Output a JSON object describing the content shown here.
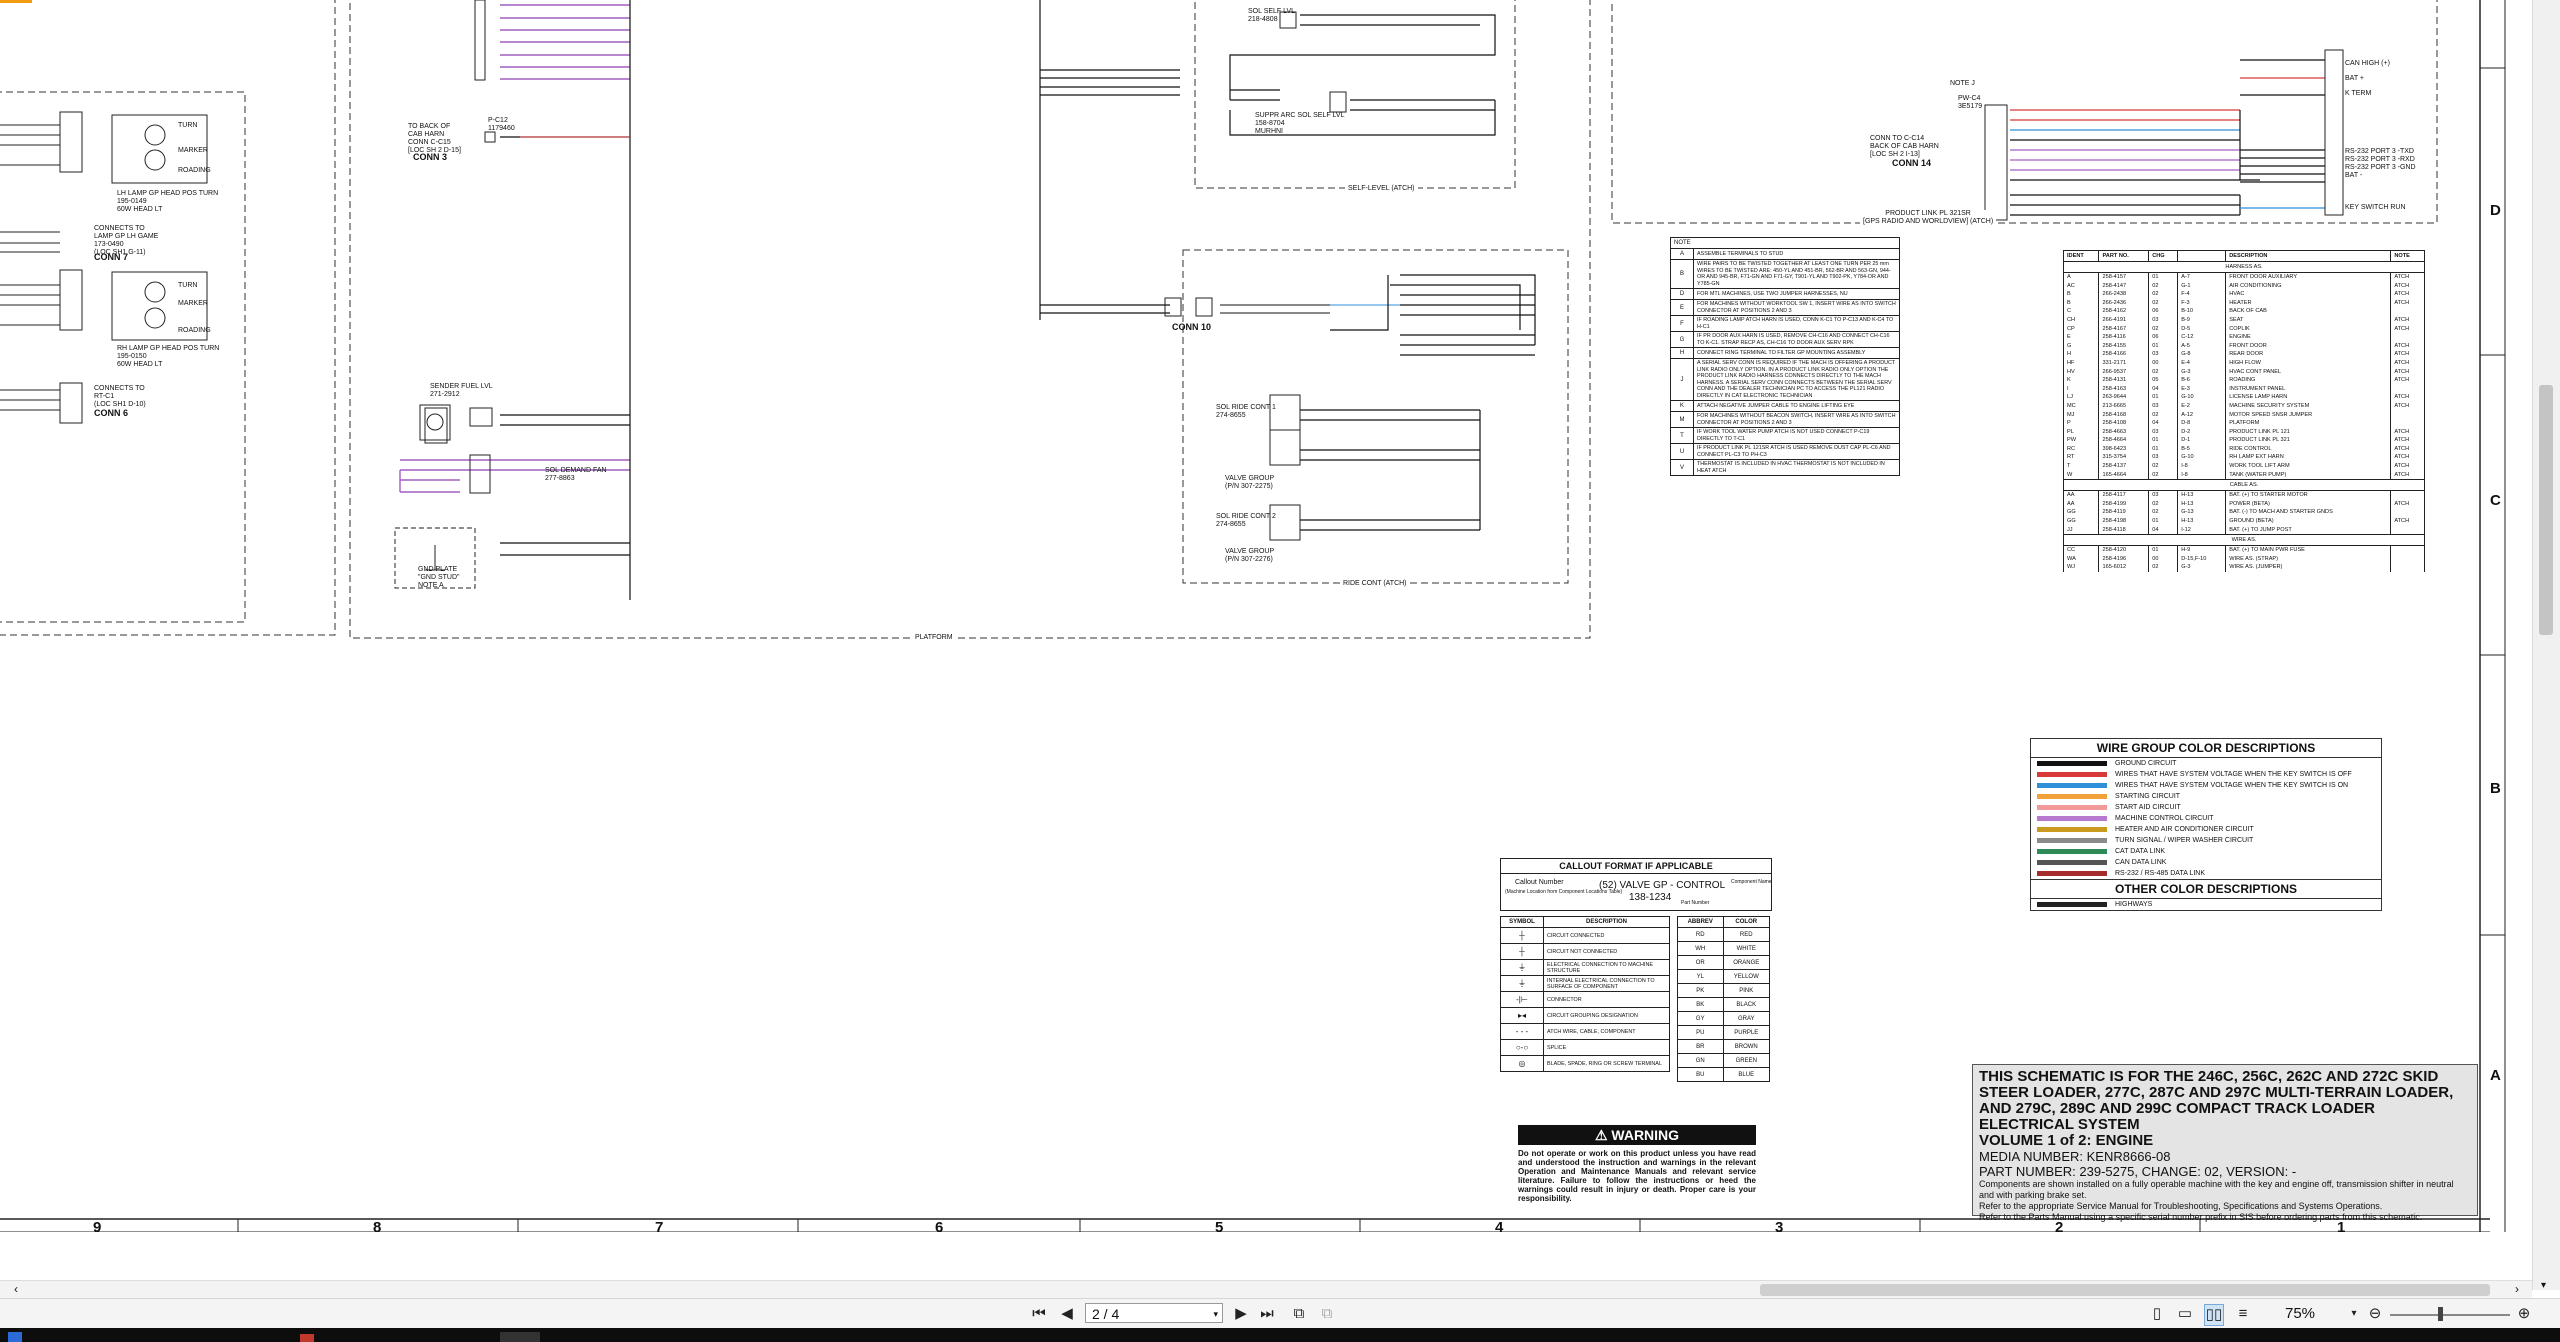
{
  "schematic": {
    "connectors": {
      "conn3": {
        "title": "CONN 3",
        "ref": "TO BACK OF\nCAB HARN\nCONN C-C15\n[LOC SH 2 D-15]",
        "pc": "P-C12\n1179460"
      },
      "conn7": {
        "title": "CONN 7",
        "desc": "CONNECTS TO\nLAMP GP LH GAME\n173-0490\n(LOC SH1 G-11)"
      },
      "conn6": {
        "title": "CONN 6",
        "desc": "CONNECTS TO\nRT-C1\n(LOC SH1 D-10)"
      },
      "conn10": {
        "title": "CONN 10"
      },
      "conn14": {
        "title": "CONN 14",
        "desc": "CONN TO C-C14\nBACK OF CAB HARN\n[LOC SH 2 I-13]"
      }
    },
    "lamp_labels": {
      "lh": "LH LAMP GP HEAD POS TURN\n195-0149\n60W HEAD LT",
      "rh": "RH LAMP GP HEAD POS TURN\n195-0150\n60W HEAD LT",
      "turn": "TURN",
      "marker": "MARKER",
      "roading": "ROADING"
    },
    "group_labels": {
      "platform": "PLATFORM",
      "self_level": "SELF-LEVEL (ATCH)",
      "ride_cont": "RIDE CONT (ATCH)",
      "product_link": "PRODUCT LINK PL 321SR\n[GPS RADIO AND WORLDVIEW] (ATCH)",
      "sender_fuel": "SENDER FUEL LVL\n271-2912",
      "sol_demand": "SOL DEMAND FAN\n277-8863",
      "gnd_plate": "GND PLATE\n\"GND STUD\"\nNOTE A",
      "sol_ride_1": "SOL RIDE CONT 1\n274-8655",
      "sol_ride_2": "SOL RIDE CONT 2\n274-8655",
      "valve_gp_1": "VALVE GROUP\n(P/N 307-2275)",
      "valve_gp_2": "VALVE GROUP\n(P/N 307-2276)",
      "sol_self_lvl": "SOL SELF LVL\n218-4808",
      "suppr_arc": "SUPPR ARC SOL SELF LVL\n158-8704\nMURHNI"
    },
    "notes_header": "NOTE",
    "notes": [
      {
        "k": "A",
        "t": "ASSEMBLE TERMINALS TO STUD"
      },
      {
        "k": "B",
        "t": "WIRE PAIRS TO BE TWISTED TOGETHER AT LEAST ONE TURN PER 25 mm WIRES TO BE TWISTED ARE: 450-YL AND 451-BR, 562-BR AND 563-GN, 944-OR AND 945-BR, F71-GN AND F71-GY, T901-YL AND T902-PK, Y784-OR AND Y785-GN"
      },
      {
        "k": "D",
        "t": "FOR MTL MACHINES, USE TWO JUMPER HARNESSES, NU"
      },
      {
        "k": "E",
        "t": "FOR MACHINES WITHOUT WORKTOOL SW 1, INSERT WIRE AS INTO SWITCH CONNECTOR AT POSITIONS 2 AND 3"
      },
      {
        "k": "F",
        "t": "IF ROADING LAMP ATCH HARN IS USED, CONN K-C1 TO P-C13 AND K-C4 TO H-C1"
      },
      {
        "k": "G",
        "t": "IF PR DOOR AUX HARN IS USED, REMOVE CH-C16 AND CONNECT CH-C16 TO K-C1. STRAP RECP AS, CH-C16 TO DOOR AUX SERV RPK"
      },
      {
        "k": "H",
        "t": "CONNECT RING TERMINAL TO FILTER GP MOUNTING ASSEMBLY"
      },
      {
        "k": "J",
        "t": "A SERIAL SERV CONN IS REQUIRED IF THE MACH IS OFFERING A PRODUCT LINK RADIO ONLY OPTION. IN A PRODUCT LINK RADIO ONLY OPTION THE PRODUCT LINK RADIO HARNESS CONNECTS DIRECTLY TO THE MACH HARNESS. A SERIAL SERV CONN CONNECTS BETWEEN THE SERIAL SERV CONN AND THE DEALER TECHNICIAN PC TO ACCESS THE PL121 RADIO DIRECTLY IN CAT ELECTRONIC TECHNICIAN"
      },
      {
        "k": "K",
        "t": "ATTACH NEGATIVE JUMPER CABLE TO ENGINE LIFTING EYE"
      },
      {
        "k": "M",
        "t": "FOR MACHINES WITHOUT BEACON SWITCH, INSERT WIRE AS INTO SWITCH CONNECTOR AT POSITIONS 2 AND 3"
      },
      {
        "k": "T",
        "t": "IF WORK TOOL WATER PUMP ATCH IS NOT USED CONNECT P-C19 DIRECTLY TO T-C1"
      },
      {
        "k": "U",
        "t": "IF PRODUCT LINK PL 121SR ATCH IS USED REMOVE DUST CAP PL-C6 AND CONNECT PL-C3 TO PH-C3"
      },
      {
        "k": "V",
        "t": "THERMOSTAT IS INCLUDED IN HVAC THERMOSTAT IS NOT INCLUDED IN HEAT ATCH"
      }
    ],
    "parts_table": {
      "headers": [
        "IDENT",
        "PART NO.",
        "CHG",
        "",
        "DESCRIPTION",
        "NOTE"
      ],
      "section_harness": "HARNESS AS.",
      "rows_harness": [
        [
          "A",
          "258-4157",
          "01",
          "A-7",
          "FRONT DOOR AUXILIARY",
          "ATCH"
        ],
        [
          "AC",
          "258-4147",
          "02",
          "G-1",
          "AIR CONDITIONING",
          "ATCH"
        ],
        [
          "B",
          "266-2438",
          "02",
          "F-4",
          "HVAC",
          "ATCH"
        ],
        [
          "B",
          "266-2436",
          "02",
          "F-3",
          "HEATER",
          "ATCH"
        ],
        [
          "C",
          "258-4162",
          "06",
          "B-10",
          "BACK OF CAB",
          ""
        ],
        [
          "CH",
          "266-4191",
          "03",
          "B-9",
          "SEAT",
          "ATCH"
        ],
        [
          "CP",
          "258-4167",
          "02",
          "D-5",
          "COPLIK",
          "ATCH"
        ],
        [
          "E",
          "258-4116",
          "06",
          "C-12",
          "ENGINE",
          ""
        ],
        [
          "G",
          "258-4155",
          "01",
          "A-5",
          "FRONT DOOR",
          "ATCH"
        ],
        [
          "H",
          "258-4166",
          "03",
          "G-8",
          "REAR DOOR",
          "ATCH"
        ],
        [
          "HF",
          "331-2171",
          "00",
          "E-4",
          "HIGH FLOW",
          "ATCH"
        ],
        [
          "HV",
          "266-9537",
          "02",
          "G-3",
          "HVAC CONT PANEL",
          "ATCH"
        ],
        [
          "K",
          "258-4131",
          "05",
          "B-6",
          "ROADING",
          "ATCH"
        ],
        [
          "I",
          "258-4163",
          "04",
          "E-3",
          "INSTRUMENT PANEL",
          ""
        ],
        [
          "LJ",
          "263-9644",
          "01",
          "G-10",
          "LICENSE LAMP HARN",
          "ATCH"
        ],
        [
          "MC",
          "213-6665",
          "03",
          "E-2",
          "MACHINE SECURITY SYSTEM",
          "ATCH"
        ],
        [
          "MJ",
          "258-4168",
          "02",
          "A-12",
          "MOTOR SPEED SNSR JUMPER",
          ""
        ],
        [
          "P",
          "258-4108",
          "04",
          "D-8",
          "PLATFORM",
          ""
        ],
        [
          "PL",
          "258-4663",
          "03",
          "D-2",
          "PRODUCT LINK PL 121",
          "ATCH"
        ],
        [
          "PW",
          "258-4664",
          "01",
          "D-1",
          "PRODUCT LINK PL 321",
          "ATCH"
        ],
        [
          "RC",
          "398-6423",
          "01",
          "B-5",
          "RIDE CONTROL",
          "ATCH"
        ],
        [
          "RT",
          "315-3754",
          "03",
          "G-10",
          "RH LAMP EXT HARN",
          "ATCH"
        ],
        [
          "T",
          "258-4137",
          "02",
          "I-8",
          "WORK TOOL LIFT ARM",
          "ATCH"
        ],
        [
          "W",
          "165-4664",
          "02",
          "I-8",
          "TANK (WATER PUMP)",
          "ATCH"
        ]
      ],
      "section_cable": "CABLE AS.",
      "rows_cable": [
        [
          "AA",
          "258-4117",
          "03",
          "H-13",
          "BAT. (+) TO STARTER MOTOR",
          ""
        ],
        [
          "AA",
          "258-4199",
          "02",
          "H-13",
          "POWER (BETA)",
          "ATCH"
        ],
        [
          "GG",
          "258-4119",
          "02",
          "G-13",
          "BAT. (-) TO MACH AND STARTER GNDS",
          ""
        ],
        [
          "GG",
          "258-4198",
          "01",
          "H-13",
          "GROUND (BETA)",
          "ATCH"
        ],
        [
          "JJ",
          "258-4118",
          "04",
          "I-12",
          "BAT. (+) TO JUMP POST",
          ""
        ]
      ],
      "section_wire": "WIRE AS.",
      "rows_wire": [
        [
          "CC",
          "258-4120",
          "01",
          "H-9",
          "BAT. (+) TO MAIN PWR FUSE",
          ""
        ],
        [
          "WA",
          "258-4196",
          "00",
          "D-15,F-10",
          "WIRE AS. (STRAP)",
          ""
        ],
        [
          "WJ",
          "165-6012",
          "02",
          "G-3",
          "WIRE AS. (JUMPER)",
          ""
        ]
      ]
    },
    "wire_legend": {
      "title": "WIRE GROUP COLOR DESCRIPTIONS",
      "items": [
        {
          "label": "GROUND CIRCUIT",
          "color": "#111111"
        },
        {
          "label": "WIRES THAT HAVE SYSTEM VOLTAGE WHEN THE KEY SWITCH IS OFF",
          "color": "#d83a3a"
        },
        {
          "label": "WIRES THAT HAVE SYSTEM VOLTAGE WHEN THE KEY SWITCH IS ON",
          "color": "#2f8fd8"
        },
        {
          "label": "STARTING CIRCUIT",
          "color": "#f0a13a"
        },
        {
          "label": "START AID CIRCUIT",
          "color": "#f29a9a"
        },
        {
          "label": "MACHINE CONTROL CIRCUIT",
          "color": "#b77ad0"
        },
        {
          "label": "HEATER AND AIR CONDITIONER CIRCUIT",
          "color": "#c99a1e"
        },
        {
          "label": "TURN SIGNAL / WIPER WASHER CIRCUIT",
          "color": "#8a8a8a"
        },
        {
          "label": "CAT DATA LINK",
          "color": "#2e8b57"
        },
        {
          "label": "CAN DATA LINK",
          "color": "#555555"
        },
        {
          "label": "RS-232 / RS-485 DATA LINK",
          "color": "#a52a2a"
        }
      ],
      "other_title": "OTHER COLOR DESCRIPTIONS",
      "other_items": [
        {
          "label": "HIGHWAYS",
          "color": "#222222"
        }
      ]
    },
    "callout": {
      "title": "CALLOUT FORMAT IF APPLICABLE",
      "example": "(52) VALVE GP - CONTROL",
      "part": "138-1234",
      "callout_number": "Callout Number",
      "callout_sub": "(Machine Location from Component Locations Table)",
      "component_name": "Component Name",
      "part_number": "Part Number"
    },
    "symbol_table": {
      "headers": [
        "SYMBOL",
        "DESCRIPTION"
      ],
      "rows": [
        [
          "CIRCUIT CONNECTED"
        ],
        [
          "CIRCUIT NOT CONNECTED"
        ],
        [
          "ELECTRICAL CONNECTION TO MACHINE STRUCTURE"
        ],
        [
          "INTERNAL ELECTRICAL CONNECTION TO SURFACE OF COMPONENT"
        ],
        [
          "CONNECTOR"
        ],
        [
          "CIRCUIT GROUPING DESIGNATION"
        ],
        [
          "ATCH WIRE, CABLE, COMPONENT"
        ],
        [
          "SPLICE"
        ],
        [
          "BLADE, SPADE, RING OR SCREW TERMINAL"
        ]
      ]
    },
    "color_table": {
      "headers": [
        "ABBREV",
        "COLOR"
      ],
      "rows": [
        [
          "RD",
          "RED"
        ],
        [
          "WH",
          "WHITE"
        ],
        [
          "OR",
          "ORANGE"
        ],
        [
          "YL",
          "YELLOW"
        ],
        [
          "PK",
          "PINK"
        ],
        [
          "BK",
          "BLACK"
        ],
        [
          "GY",
          "GRAY"
        ],
        [
          "PU",
          "PURPLE"
        ],
        [
          "BR",
          "BROWN"
        ],
        [
          "GN",
          "GREEN"
        ],
        [
          "BU",
          "BLUE"
        ]
      ]
    },
    "warning": {
      "title": "WARNING",
      "text": "Do not operate or work on this product unless you have read and understood the instruction and warnings in the relevant Operation and Maintenance Manuals and relevant service literature. Failure to follow the instructions or heed the warnings could result in injury or death. Proper care is your responsibility."
    },
    "title_block": {
      "title": "THIS SCHEMATIC IS FOR THE 246C, 256C, 262C AND 272C SKID STEER LOADER, 277C, 287C AND 297C MULTI-TERRAIN LOADER, AND 279C, 289C AND 299C COMPACT TRACK LOADER ELECTRICAL SYSTEM",
      "volume": "VOLUME 1 of 2: ENGINE",
      "media": "MEDIA NUMBER: KENR8666-08",
      "part": "PART NUMBER: 239-5275, CHANGE: 02, VERSION: -",
      "note1": "Components are shown installed on a fully operable machine with the key and engine off, transmission shifter in neutral and with parking brake set.",
      "note2": "Refer to the appropriate Service Manual for Troubleshooting, Specifications and Systems Operations.",
      "note3": "Refer to the Parts Manual using a specific serial number prefix in SIS before ordering parts from this schematic."
    },
    "frame_numbers": [
      "9",
      "8",
      "7",
      "6",
      "5",
      "4",
      "3",
      "2",
      "1"
    ],
    "zone_letters": [
      "D",
      "C",
      "B",
      "A"
    ],
    "note_j": "NOTE J",
    "pw_c4": "PW-C4\n3E5179",
    "can_labels": [
      "CAN HIGH (+)",
      "BAT +",
      "K TERM",
      "RS-232 PORT 3 -TXD",
      "RS-232 PORT 3 -RXD",
      "RS-232 PORT 3 -GND",
      "BAT -",
      "KEY SWITCH RUN"
    ]
  },
  "viewer": {
    "page_current": "2 / 4",
    "zoom": "75%",
    "nav": {
      "first": "⏮",
      "prev": "◀",
      "next": "▶",
      "last": "⏭"
    }
  }
}
